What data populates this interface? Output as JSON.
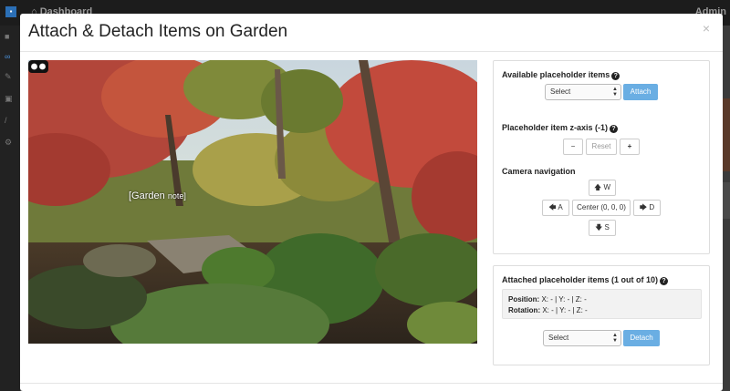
{
  "background": {
    "breadcrumb": "Dashboard",
    "user": "Admin"
  },
  "modal": {
    "title": "Attach & Detach Items on Garden",
    "close_label": "×"
  },
  "viewer": {
    "note_main": "[Garden ",
    "note_small": "note]"
  },
  "available": {
    "label": "Available placeholder items",
    "select_value": "Select",
    "attach_label": "Attach"
  },
  "zaxis": {
    "label": "Placeholder item z-axis (-1)",
    "minus_label": "−",
    "reset_label": "Reset",
    "plus_label": "+"
  },
  "camera": {
    "label": "Camera navigation",
    "w_label": "W",
    "a_label": "A",
    "center_label": "Center (0, 0, 0)",
    "d_label": "D",
    "s_label": "S"
  },
  "attached": {
    "label": "Attached placeholder items (1 out of 10)",
    "position_label": "Position:",
    "position_value": " X: - | Y: - | Z: -",
    "rotation_label": "Rotation:",
    "rotation_value": " X: - | Y: - | Z: -",
    "select_value": "Select",
    "detach_label": "Detach"
  },
  "colors": {
    "primary": "#6aaee3"
  }
}
